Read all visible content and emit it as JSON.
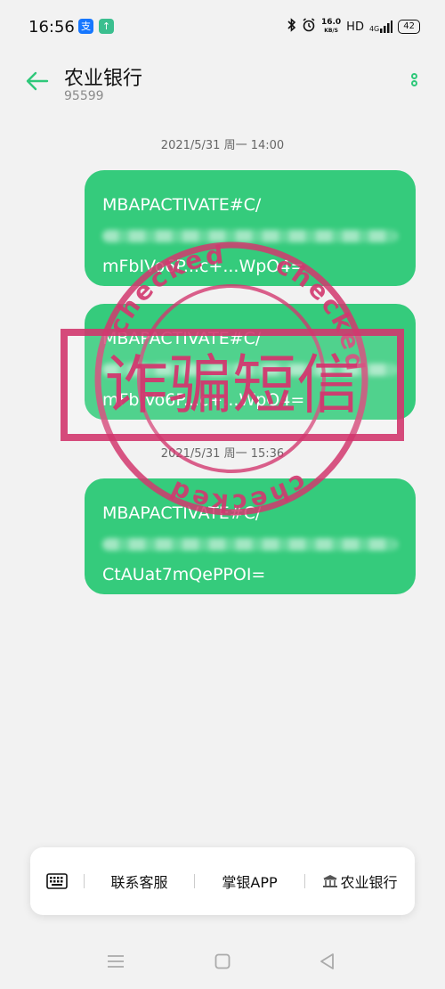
{
  "status_bar": {
    "time": "16:56",
    "speed_value": "16.0",
    "speed_unit": "KB/S",
    "network_mode": "HD",
    "network_type": "4G",
    "battery": "42"
  },
  "header": {
    "title": "农业银行",
    "number": "95599"
  },
  "messages": [
    {
      "timestamp": "2021/5/31 周一 14:00",
      "line1": "MBAPACTIVATE#C/",
      "line3": "mFbIVo6P...c+...WpO4="
    },
    {
      "line1": "MBAPACTIVATE#C/",
      "line3": "mFbIVo6P...c+...WpO4="
    },
    {
      "timestamp": "2021/5/31 周一 15:36",
      "line1": "MBAPACTIVATE#C/",
      "line3": "CtAUat7mQePPOI="
    }
  ],
  "stamp": {
    "text": "诈骗短信",
    "ring_text": "checked",
    "color": "#d2386f"
  },
  "bottom_bar": {
    "item1": "联系客服",
    "item2": "掌银APP",
    "item3": "农业银行"
  },
  "colors": {
    "accent": "#2fc87a",
    "bubble": "#35cb7c",
    "stamp": "#d2386f"
  }
}
